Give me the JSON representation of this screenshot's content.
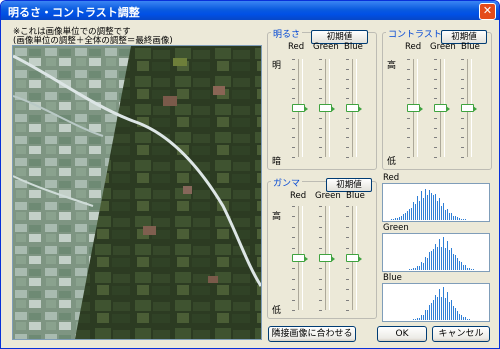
{
  "window": {
    "title": "明るさ・コントラスト調整",
    "close_glyph": "✕"
  },
  "notes": {
    "line1": "※これは画像単位での調整です",
    "line2": "(画像単位の調整＋全体の調整＝最終画像)"
  },
  "brightness": {
    "title": "明るさ",
    "reset_label": "初期値",
    "high_label": "明",
    "low_label": "暗",
    "channels": [
      "Red",
      "Green",
      "Blue"
    ],
    "levels": [
      0.5,
      0.5,
      0.5
    ]
  },
  "contrast": {
    "title": "コントラスト",
    "reset_label": "初期値",
    "high_label": "高",
    "low_label": "低",
    "channels": [
      "Red",
      "Green",
      "Blue"
    ],
    "levels": [
      0.5,
      0.5,
      0.5
    ]
  },
  "gamma": {
    "title": "ガンマ",
    "reset_label": "初期値",
    "high_label": "高",
    "low_label": "低",
    "channels": [
      "Red",
      "Green",
      "Blue"
    ],
    "levels": [
      0.5,
      0.5,
      0.5
    ]
  },
  "histograms": {
    "labels": [
      "Red",
      "Green",
      "Blue"
    ],
    "color": "#2f7fd6"
  },
  "buttons": {
    "match": "隣接画像に合わせる",
    "ok": "OK",
    "cancel": "キャンセル"
  }
}
